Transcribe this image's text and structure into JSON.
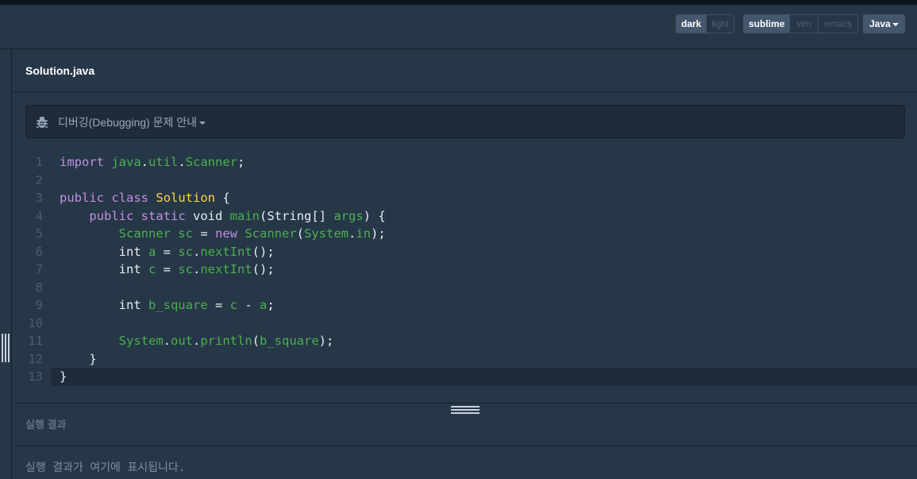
{
  "toolbar": {
    "theme": [
      "dark",
      "light"
    ],
    "keymap": [
      "sublime",
      "vim",
      "emacs"
    ],
    "language": "Java"
  },
  "file": {
    "name": "Solution.java"
  },
  "notice": {
    "label": "디버깅(Debugging) 문제 안내"
  },
  "code": [
    [
      [
        "kw",
        "import"
      ],
      [
        "pl",
        " "
      ],
      [
        "gr",
        "java"
      ],
      [
        "pl",
        "."
      ],
      [
        "gr",
        "util"
      ],
      [
        "pl",
        "."
      ],
      [
        "gr",
        "Scanner"
      ],
      [
        "pl",
        ";"
      ]
    ],
    [],
    [
      [
        "kw",
        "public"
      ],
      [
        "pl",
        " "
      ],
      [
        "kw",
        "class"
      ],
      [
        "pl",
        " "
      ],
      [
        "cl",
        "Solution"
      ],
      [
        "pl",
        " {"
      ]
    ],
    [
      [
        "pl",
        "    "
      ],
      [
        "kw",
        "public"
      ],
      [
        "pl",
        " "
      ],
      [
        "kw",
        "static"
      ],
      [
        "pl",
        " void "
      ],
      [
        "gr",
        "main"
      ],
      [
        "pl",
        "(String[] "
      ],
      [
        "gr",
        "args"
      ],
      [
        "pl",
        ") {"
      ]
    ],
    [
      [
        "pl",
        "        "
      ],
      [
        "gr",
        "Scanner sc"
      ],
      [
        "pl",
        " = "
      ],
      [
        "kw",
        "new"
      ],
      [
        "pl",
        " "
      ],
      [
        "gr",
        "Scanner"
      ],
      [
        "pl",
        "("
      ],
      [
        "gr",
        "System"
      ],
      [
        "pl",
        "."
      ],
      [
        "gr",
        "in"
      ],
      [
        "pl",
        ");"
      ]
    ],
    [
      [
        "pl",
        "        int "
      ],
      [
        "gr",
        "a"
      ],
      [
        "pl",
        " = "
      ],
      [
        "gr",
        "sc"
      ],
      [
        "pl",
        "."
      ],
      [
        "gr",
        "nextInt"
      ],
      [
        "pl",
        "();"
      ]
    ],
    [
      [
        "pl",
        "        int "
      ],
      [
        "gr",
        "c"
      ],
      [
        "pl",
        " = "
      ],
      [
        "gr",
        "sc"
      ],
      [
        "pl",
        "."
      ],
      [
        "gr",
        "nextInt"
      ],
      [
        "pl",
        "();"
      ]
    ],
    [],
    [
      [
        "pl",
        "        int "
      ],
      [
        "gr",
        "b_square"
      ],
      [
        "pl",
        " = "
      ],
      [
        "gr",
        "c"
      ],
      [
        "pl",
        " - "
      ],
      [
        "gr",
        "a"
      ],
      [
        "pl",
        ";"
      ]
    ],
    [],
    [
      [
        "pl",
        "        "
      ],
      [
        "gr",
        "System"
      ],
      [
        "pl",
        "."
      ],
      [
        "gr",
        "out"
      ],
      [
        "pl",
        "."
      ],
      [
        "gr",
        "println"
      ],
      [
        "pl",
        "("
      ],
      [
        "gr",
        "b_square"
      ],
      [
        "pl",
        ");"
      ]
    ],
    [
      [
        "pl",
        "    }"
      ]
    ],
    [
      [
        "pl",
        "}"
      ]
    ]
  ],
  "result": {
    "heading": "실행 결과",
    "placeholder": "실행 결과가 여기에 표시됩니다."
  }
}
